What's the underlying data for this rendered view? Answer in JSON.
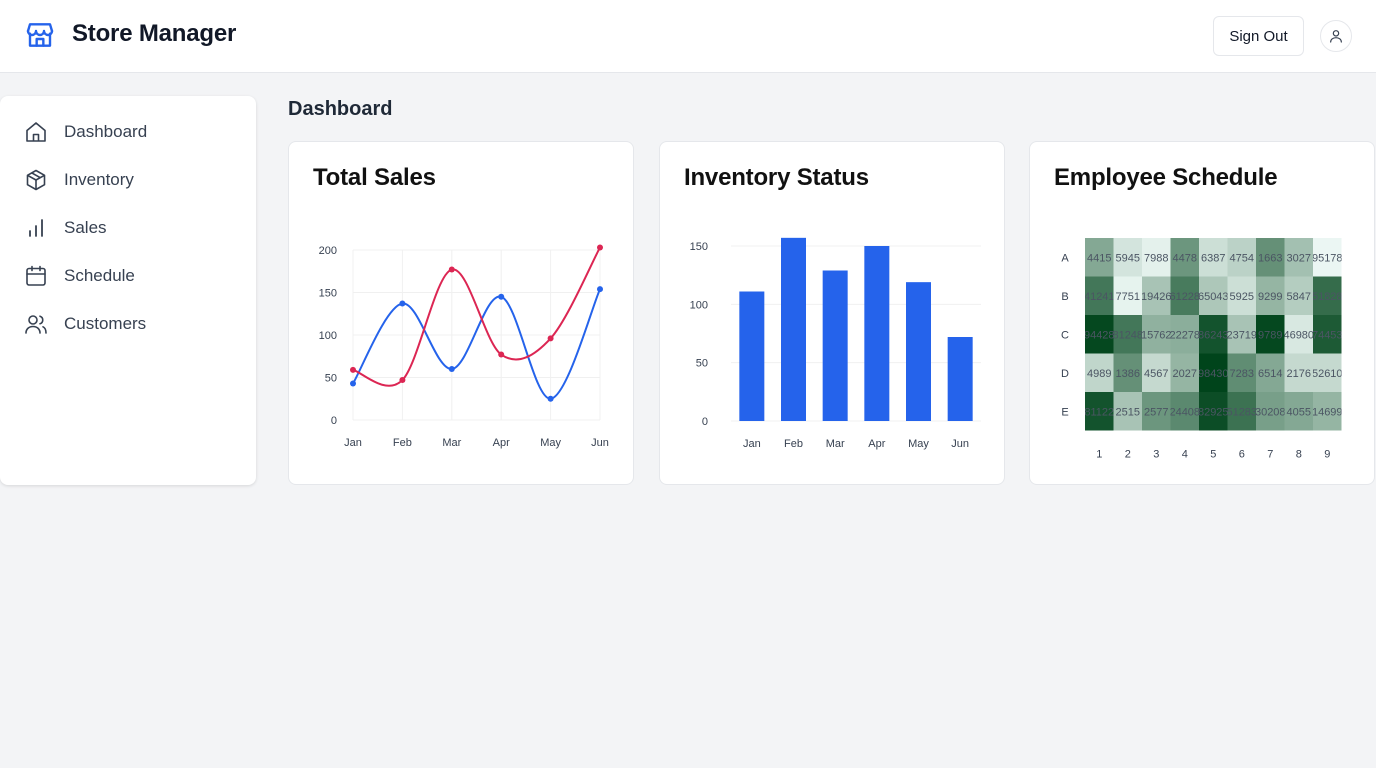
{
  "app": {
    "title": "Store Manager"
  },
  "header": {
    "sign_out_label": "Sign Out"
  },
  "sidebar": {
    "items": [
      {
        "label": "Dashboard",
        "icon": "home-icon"
      },
      {
        "label": "Inventory",
        "icon": "package-icon"
      },
      {
        "label": "Sales",
        "icon": "bar-chart-icon"
      },
      {
        "label": "Schedule",
        "icon": "calendar-icon"
      },
      {
        "label": "Customers",
        "icon": "users-icon"
      }
    ]
  },
  "main": {
    "title": "Dashboard"
  },
  "colors": {
    "accent": "#2563eb",
    "red": "#dc2653",
    "green": "#1b8a46"
  },
  "cards": {
    "sales": {
      "title": "Total Sales"
    },
    "inventory": {
      "title": "Inventory Status"
    },
    "schedule": {
      "title": "Employee Schedule"
    }
  },
  "chart_data": [
    {
      "type": "line",
      "categories": [
        "Jan",
        "Feb",
        "Mar",
        "Apr",
        "May",
        "Jun"
      ],
      "y_ticks": [
        0,
        50,
        100,
        150,
        200
      ],
      "ylim": [
        0,
        200
      ],
      "grid": true,
      "series": [
        {
          "color": "#2563eb",
          "values": [
            43,
            137,
            60,
            145,
            25,
            154
          ]
        },
        {
          "color": "#dc2653",
          "values": [
            59,
            47,
            177,
            77,
            96,
            203
          ]
        }
      ]
    },
    {
      "type": "bar",
      "categories": [
        "Jan",
        "Feb",
        "Mar",
        "Apr",
        "May",
        "Jun"
      ],
      "values": [
        111,
        157,
        129,
        150,
        119,
        72
      ],
      "y_ticks": [
        0,
        50,
        100,
        150
      ],
      "ylim": [
        0,
        150
      ],
      "grid": true,
      "color": "#2563eb"
    },
    {
      "type": "heatmap",
      "rows": [
        "A",
        "B",
        "C",
        "D",
        "E"
      ],
      "columns": [
        "1",
        "2",
        "3",
        "4",
        "5",
        "6",
        "7",
        "8",
        "9"
      ],
      "cell_labels": [
        [
          "4415",
          "5945",
          "7988",
          "4478",
          "6387",
          "4754",
          "1663",
          "3027",
          "95178"
        ],
        [
          "41241",
          "7751",
          "19426",
          "61228",
          "65043",
          "5925",
          "9299",
          "5847",
          "51828"
        ],
        [
          "94428",
          "81248",
          "15762",
          "22278",
          "86243",
          "23719",
          "9789",
          "46980",
          "74453"
        ],
        [
          "4989",
          "1386",
          "4567",
          "2027",
          "98430",
          "7283",
          "6514",
          "2176",
          "52610"
        ],
        [
          "81122",
          "2515",
          "2577",
          "24408",
          "82925",
          "51283",
          "30208",
          "4055",
          "14699"
        ]
      ],
      "intensity": [
        [
          0.45,
          0.12,
          0.05,
          0.55,
          0.15,
          0.22,
          0.58,
          0.32,
          0.02
        ],
        [
          0.72,
          0.04,
          0.3,
          0.7,
          0.28,
          0.15,
          0.38,
          0.25,
          0.78
        ],
        [
          0.98,
          0.72,
          0.4,
          0.42,
          0.92,
          0.3,
          0.98,
          0.1,
          0.88
        ],
        [
          0.2,
          0.58,
          0.18,
          0.38,
          1.0,
          0.6,
          0.45,
          0.18,
          0.18
        ],
        [
          0.92,
          0.3,
          0.55,
          0.62,
          0.95,
          0.75,
          0.5,
          0.45,
          0.38
        ]
      ]
    }
  ]
}
